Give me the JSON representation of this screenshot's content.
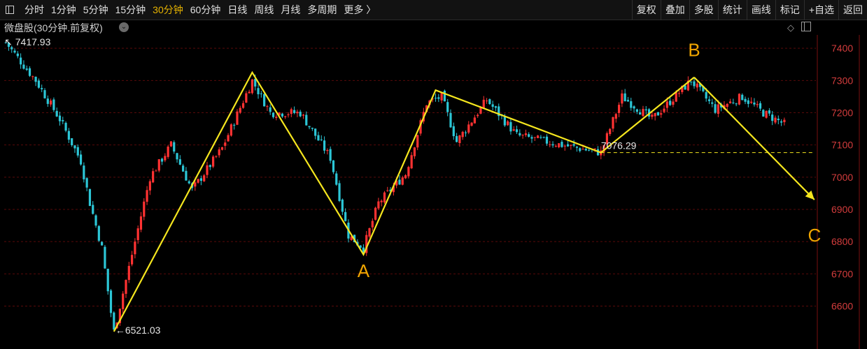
{
  "toolbar": {
    "periods": [
      "分时",
      "1分钟",
      "5分钟",
      "15分钟",
      "30分钟",
      "60分钟",
      "日线",
      "周线",
      "月线",
      "多周期",
      "更多 〉"
    ],
    "active_period": "30分钟",
    "tools": [
      "复权",
      "叠加",
      "多股",
      "统计",
      "画线",
      "标记",
      "+自选",
      "返回"
    ]
  },
  "subheader": {
    "title": "微盘股(30分钟.前复权)",
    "dropdown_glyph": "⌄",
    "diamond_glyph": "◇"
  },
  "colors": {
    "up": "#ff3232",
    "down": "#2cc6d6",
    "annotation": "#f5e61e",
    "label_orange": "#f0a500",
    "grid": "#5a0a0a",
    "axis_text": "#d23c3c"
  },
  "chart_data": {
    "type": "candlestick",
    "timeframe": "30分钟",
    "ylim": [
      6521,
      7460
    ],
    "y_ticks": [
      6600,
      6700,
      6800,
      6900,
      7000,
      7100,
      7200,
      7300,
      7400
    ],
    "grid": true,
    "candles_count": 260,
    "price_path": [
      {
        "index": 0,
        "value": 7417.93
      },
      {
        "index": 10,
        "value": 7300
      },
      {
        "index": 18,
        "value": 7180
      },
      {
        "index": 25,
        "value": 7050
      },
      {
        "index": 28,
        "value": 6920
      },
      {
        "index": 32,
        "value": 6780
      },
      {
        "index": 35,
        "value": 6580
      },
      {
        "index": 36,
        "value": 6521.03
      },
      {
        "index": 42,
        "value": 6760
      },
      {
        "index": 48,
        "value": 7000
      },
      {
        "index": 55,
        "value": 7100
      },
      {
        "index": 62,
        "value": 6960
      },
      {
        "index": 72,
        "value": 7090
      },
      {
        "index": 82,
        "value": 7300
      },
      {
        "index": 88,
        "value": 7200
      },
      {
        "index": 98,
        "value": 7200
      },
      {
        "index": 108,
        "value": 7060
      },
      {
        "index": 114,
        "value": 6820
      },
      {
        "index": 119,
        "value": 6780
      },
      {
        "index": 124,
        "value": 6920
      },
      {
        "index": 133,
        "value": 7010
      },
      {
        "index": 140,
        "value": 7230
      },
      {
        "index": 145,
        "value": 7250
      },
      {
        "index": 150,
        "value": 7110
      },
      {
        "index": 160,
        "value": 7240
      },
      {
        "index": 170,
        "value": 7130
      },
      {
        "index": 185,
        "value": 7100
      },
      {
        "index": 198,
        "value": 7076.29
      },
      {
        "index": 205,
        "value": 7250
      },
      {
        "index": 215,
        "value": 7180
      },
      {
        "index": 228,
        "value": 7300
      },
      {
        "index": 236,
        "value": 7210
      },
      {
        "index": 245,
        "value": 7250
      },
      {
        "index": 252,
        "value": 7200
      },
      {
        "index": 259,
        "value": 7165
      }
    ],
    "markers": [
      {
        "label": "7417.93",
        "index": 0,
        "value": 7417.93,
        "arrow": "↖",
        "type": "high"
      },
      {
        "label": "6521.03",
        "index": 36,
        "value": 6521.03,
        "arrow": "←",
        "type": "low"
      },
      {
        "label": "7076.29",
        "index": 198,
        "value": 7076.29,
        "type": "support"
      }
    ],
    "support_line": {
      "value": 7076.29,
      "from_index": 198,
      "to_index": 269
    },
    "wave_line": [
      {
        "index": 36,
        "value": 6521.03
      },
      {
        "index": 82,
        "value": 7325
      },
      {
        "index": 119,
        "value": 6760
      },
      {
        "index": 143,
        "value": 7270
      },
      {
        "index": 198,
        "value": 7076.29
      },
      {
        "index": 229,
        "value": 7310
      }
    ],
    "projection_arrow": {
      "from": {
        "index": 229,
        "value": 7310
      },
      "to": {
        "index": 269,
        "value": 6930
      }
    },
    "wave_labels": [
      {
        "text": "A",
        "index": 119,
        "value": 6690
      },
      {
        "text": "B",
        "index": 229,
        "value": 7375
      },
      {
        "text": "C",
        "index": 269,
        "value": 6800
      }
    ]
  }
}
